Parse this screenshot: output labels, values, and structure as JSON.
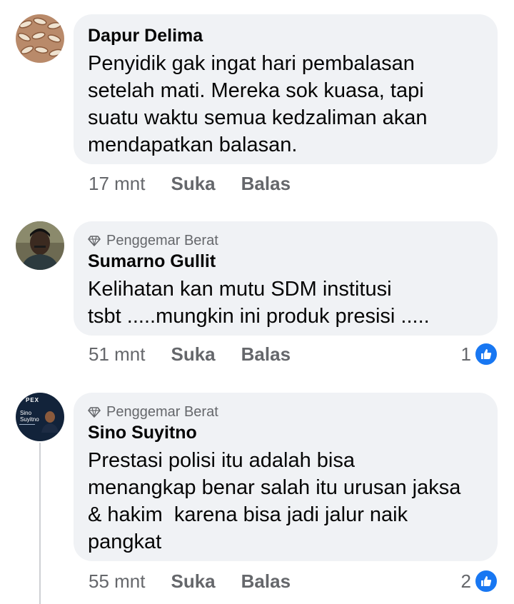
{
  "comments": [
    {
      "badge": "",
      "author": "Dapur Delima",
      "text": "Penyidik gak ingat hari pembalasan\nsetelah mati. Mereka sok kuasa, tapi\nsuatu waktu semua kedzaliman akan\nmendapatkan balasan.",
      "time": "17 mnt",
      "like_label": "Suka",
      "reply_label": "Balas",
      "reaction_count": ""
    },
    {
      "badge": "Penggemar Berat",
      "author": "Sumarno Gullit",
      "text": "Kelihatan kan mutu SDM institusi\ntsbt .....mungkin ini produk presisi .....",
      "time": "51 mnt",
      "like_label": "Suka",
      "reply_label": "Balas",
      "reaction_count": "1"
    },
    {
      "badge": "Penggemar Berat",
      "author": "Sino Suyitno",
      "text": "Prestasi polisi itu adalah bisa\nmenangkap benar salah itu urusan jaksa\n& hakim  karena bisa jadi jalur naik\npangkat",
      "time": "55 mnt",
      "like_label": "Suka",
      "reply_label": "Balas",
      "reaction_count": "2"
    }
  ],
  "avatar3_text": {
    "brand": "PEX",
    "line1": "Sino",
    "line2": "Suyitno"
  },
  "colors": {
    "bubble": "#f0f2f5",
    "meta_text": "#65676b",
    "like_blue": "#1877f2",
    "text": "#050505"
  },
  "icons": {
    "badge": "diamond-icon",
    "reaction": "thumbs-up-icon"
  }
}
